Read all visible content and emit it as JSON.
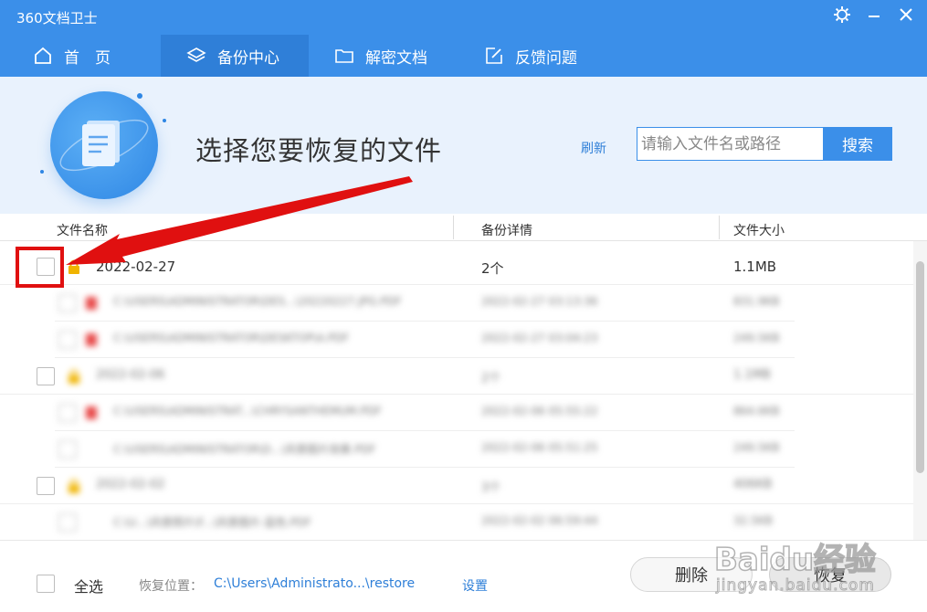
{
  "app": {
    "title": "360文档卫士"
  },
  "tabs": [
    {
      "label": "首　页",
      "icon": "home-icon"
    },
    {
      "label": "备份中心",
      "icon": "layers-icon"
    },
    {
      "label": "解密文档",
      "icon": "folder-icon"
    },
    {
      "label": "反馈问题",
      "icon": "edit-icon"
    }
  ],
  "active_tab": "备份中心",
  "banner": {
    "title": "选择您要恢复的文件",
    "refresh_label": "刷新",
    "search_placeholder": "请输入文件名或路径",
    "search_button": "搜索"
  },
  "table": {
    "columns": [
      "文件名称",
      "备份详情",
      "文件大小"
    ],
    "rows": [
      {
        "type": "group",
        "name": "2022-02-27",
        "detail": "2个",
        "size": "1.1MB"
      },
      {
        "type": "file",
        "name": "C:\\USERS\\ADMINISTRATOR\\DES...\\20220227.JPG.PDF",
        "detail": "2022-02-27 03:13:36",
        "size": "831.9KB"
      },
      {
        "type": "file",
        "name": "C:\\USERS\\ADMINISTRATOR\\DESKTOP\\A.PDF",
        "detail": "2022-02-27 03:04:23",
        "size": "249.5KB"
      },
      {
        "type": "group",
        "name": "2022-02-06",
        "detail": "2个",
        "size": "1.1MB"
      },
      {
        "type": "file",
        "name": "C:\\USERS\\ADMINISTRAT...\\CHRYSANTHEMUM.PDF",
        "detail": "2022-02-06 05:55:22",
        "size": "864.6KB"
      },
      {
        "type": "file",
        "name": "C:\\USERS\\ADMINISTRATOR\\D...\\风景图片效果.PDF",
        "detail": "2022-02-06 05:51:25",
        "size": "249.5KB"
      },
      {
        "type": "group",
        "name": "2022-02-02",
        "detail": "3个",
        "size": "406KB"
      },
      {
        "type": "file",
        "name": "C:\\U...\\风景照片\\F...\\风景图片-蓝色.PDF",
        "detail": "2022-02-02 06:59:44",
        "size": "32.5KB"
      }
    ]
  },
  "bottom": {
    "select_all": "全选",
    "restore_location_label": "恢复位置：",
    "restore_path": "C:\\Users\\Administrato...\\restore",
    "settings_label": "设置",
    "delete_button": "删除",
    "restore_button": "恢复"
  },
  "watermark": {
    "text": "Baidu经验",
    "sub": "jingyan.baidu.com"
  },
  "colors": {
    "accent": "#3b8fe9",
    "annotation": "#e01010",
    "link": "#2e7fd8"
  }
}
